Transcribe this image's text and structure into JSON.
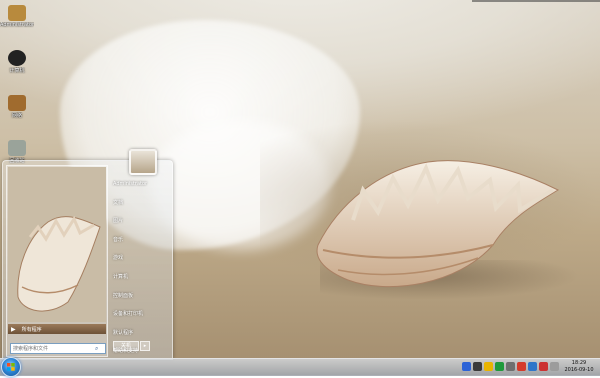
{
  "desktop": {
    "icons": [
      {
        "name": "computer-icon",
        "label": "Administrator",
        "color": "#b88a3d"
      },
      {
        "name": "network-icon",
        "label": "计算机",
        "color": "#222222"
      },
      {
        "name": "control-icon",
        "label": "网络",
        "color": "#a06b2e"
      },
      {
        "name": "recycle-icon",
        "label": "回收站",
        "color": "#9aa39a"
      }
    ]
  },
  "start_menu": {
    "all_programs": "所有程序",
    "search_placeholder": "搜索程序和文件",
    "right_items": [
      "Administrator",
      "文档",
      "图片",
      "音乐",
      "游戏",
      "计算机",
      "控制面板",
      "设备和打印机",
      "默认程序",
      "帮助和支持"
    ],
    "shutdown_label": "关机",
    "shutdown_arrow": "▸"
  },
  "taskbar": {
    "clock_time": "18:29",
    "clock_date": "2016-09-10",
    "tray_icon_colors": [
      "#2c63d6",
      "#3a3a3a",
      "#e9b400",
      "#1f9a3b",
      "#6f6f6f",
      "#d43b2b",
      "#2f76c9",
      "#cc3333",
      "#9c9c9c",
      "#444444"
    ]
  }
}
